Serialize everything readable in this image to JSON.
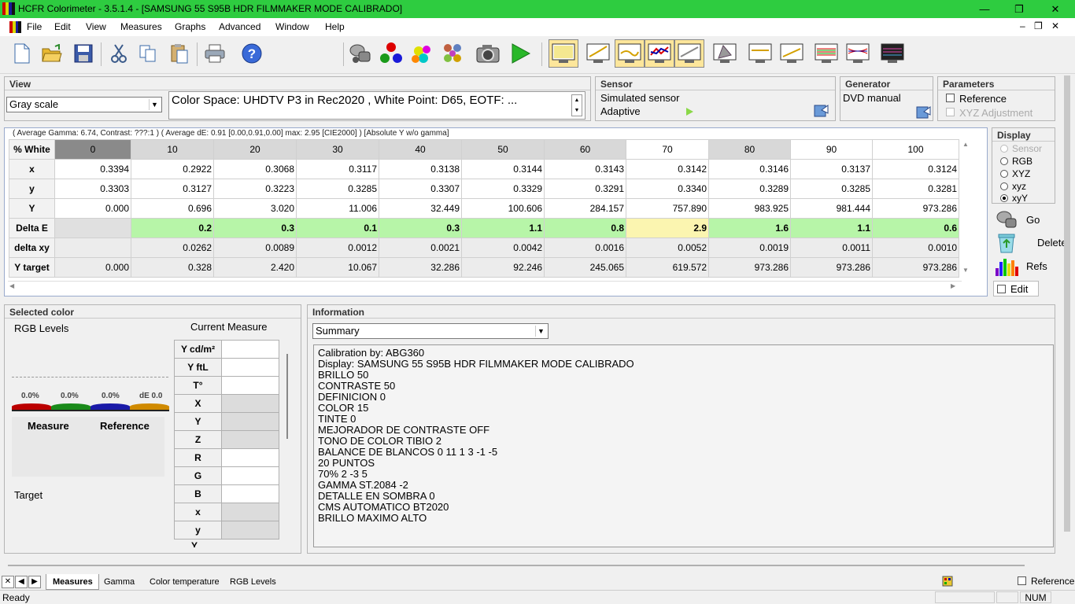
{
  "window": {
    "title": "HCFR Colorimeter - 3.5.1.4 - [SAMSUNG 55 S95B HDR FILMMAKER MODE CALIBRADO]"
  },
  "menu": {
    "items": [
      "File",
      "Edit",
      "View",
      "Measures",
      "Graphs",
      "Advanced",
      "Window",
      "Help"
    ]
  },
  "view": {
    "title": "View",
    "selected": "Gray scale",
    "colorspace": "Color Space: UHDTV P3 in Rec2020 , White Point: D65, EOTF: ..."
  },
  "sensor": {
    "title": "Sensor",
    "name": "Simulated sensor",
    "mode": "Adaptive"
  },
  "generator": {
    "title": "Generator",
    "name": "DVD manual"
  },
  "parameters": {
    "title": "Parameters",
    "reference": "Reference",
    "xyz_adjustment": "XYZ Adjustment"
  },
  "display": {
    "title": "Display",
    "options": [
      "Sensor",
      "RGB",
      "XYZ",
      "xyz",
      "xyY"
    ],
    "selected": "xyY"
  },
  "side": {
    "go": "Go",
    "delete": "Delete",
    "refs": "Refs",
    "edit": "Edit"
  },
  "grid": {
    "info": "( Average Gamma: 6.74, Contrast: ???:1 ) ( Average dE: 0.91 [0.00,0.91,0.00] max: 2.95 [CIE2000] ) [Absolute Y w/o gamma]",
    "corner": "% White",
    "columns": [
      "0",
      "10",
      "20",
      "30",
      "40",
      "50",
      "60",
      "70",
      "80",
      "90",
      "100"
    ],
    "rows": [
      {
        "label": "x",
        "values": [
          "0.3394",
          "0.2922",
          "0.3068",
          "0.3117",
          "0.3138",
          "0.3144",
          "0.3143",
          "0.3142",
          "0.3146",
          "0.3137",
          "0.3124"
        ]
      },
      {
        "label": "y",
        "values": [
          "0.3303",
          "0.3127",
          "0.3223",
          "0.3285",
          "0.3307",
          "0.3329",
          "0.3291",
          "0.3340",
          "0.3289",
          "0.3285",
          "0.3281"
        ]
      },
      {
        "label": "Y",
        "values": [
          "0.000",
          "0.696",
          "3.020",
          "11.006",
          "32.449",
          "100.606",
          "284.157",
          "757.890",
          "983.925",
          "981.444",
          "973.286"
        ]
      },
      {
        "label": "Delta E",
        "values": [
          "",
          "0.2",
          "0.3",
          "0.1",
          "0.3",
          "1.1",
          "0.8",
          "2.9",
          "1.6",
          "1.1",
          "0.6"
        ]
      },
      {
        "label": "delta xy",
        "values": [
          "",
          "0.0262",
          "0.0089",
          "0.0012",
          "0.0021",
          "0.0042",
          "0.0016",
          "0.0052",
          "0.0019",
          "0.0011",
          "0.0010"
        ]
      },
      {
        "label": "Y target",
        "values": [
          "0.000",
          "0.328",
          "2.420",
          "10.067",
          "32.286",
          "92.246",
          "245.065",
          "619.572",
          "973.286",
          "973.286",
          "973.286"
        ]
      }
    ]
  },
  "selected_color": {
    "title": "Selected color",
    "rgb_levels": "RGB Levels",
    "current_measure": "Current Measure",
    "levels": [
      "0.0%",
      "0.0%",
      "0.0%",
      "dE 0.0"
    ],
    "measure": "Measure",
    "reference": "Reference",
    "target": "Target",
    "cm_rows": [
      "Y cd/m²",
      "Y ftL",
      "T°",
      "X",
      "Y",
      "Z",
      "R",
      "G",
      "B",
      "x",
      "y",
      "Y"
    ]
  },
  "information": {
    "title": "Information",
    "selected": "Summary",
    "text": "Calibration by: ABG360\nDisplay: SAMSUNG 55 S95B HDR FILMMAKER MODE CALIBRADO\nBRILLO 50\nCONTRASTE 50\nDEFINICION 0\nCOLOR 15\nTINTE 0\nMEJORADOR DE CONTRASTE OFF\nTONO DE COLOR TIBIO 2\nBALANCE DE BLANCOS 0 11 1 3 -1 -5\n20 PUNTOS\n70% 2 -3 5\nGAMMA ST.2084 -2\nDETALLE EN SOMBRA 0\nCMS AUTOMATICO BT2020\nBRILLO MAXIMO ALTO"
  },
  "tabs": [
    "Measures",
    "Gamma",
    "Color temperature",
    "RGB Levels"
  ],
  "tabs_reference": "Reference",
  "status": {
    "text": "Ready",
    "num": "NUM"
  },
  "colors": {
    "titlebar": "#2ecc40",
    "deltae_good": "#b7f5a8",
    "deltae_warn": "#fbf5b0"
  }
}
